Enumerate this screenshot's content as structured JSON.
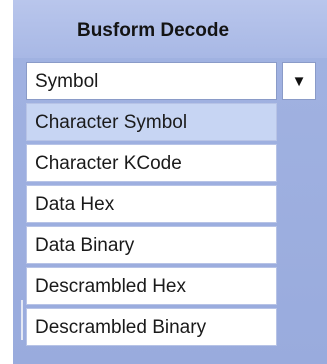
{
  "panel": {
    "title": "Busform Decode"
  },
  "combo": {
    "value": "Symbol",
    "arrow": "▼",
    "arrow_icon": "triangle-down-icon"
  },
  "options": [
    {
      "label": "Character Symbol"
    },
    {
      "label": "Character KCode"
    },
    {
      "label": "Data Hex"
    },
    {
      "label": "Data Binary"
    },
    {
      "label": "Descrambled Hex"
    },
    {
      "label": "Descrambled Binary"
    }
  ],
  "selected_index": 0,
  "colors": {
    "panel": "#a2b3e2",
    "header": "#b9c6ec",
    "selected": "#c7d5f3"
  }
}
